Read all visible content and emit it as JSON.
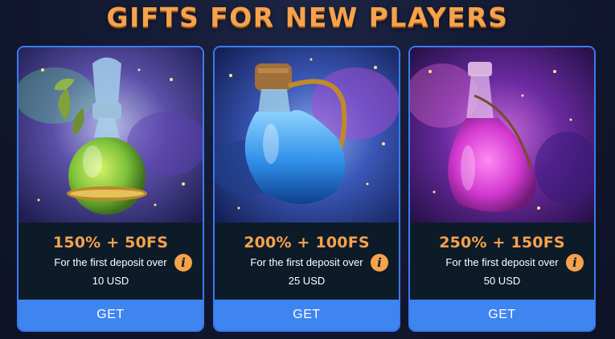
{
  "header": {
    "title": "GIFTS FOR NEW PLAYERS"
  },
  "colors": {
    "accent": "#f6a24c",
    "button": "#3f85f0",
    "border": "#3b7bf0",
    "panel": "#0d1b29"
  },
  "offers": [
    {
      "bonus": "150% + 50FS",
      "desc_line1": "For the first deposit over",
      "desc_line2": "10 USD",
      "button_label": "GET",
      "potion_color": "#7dc23a",
      "icon": "info-icon"
    },
    {
      "bonus": "200% + 100FS",
      "desc_line1": "For the first deposit over",
      "desc_line2": "25 USD",
      "button_label": "GET",
      "potion_color": "#3aa3f0",
      "icon": "info-icon"
    },
    {
      "bonus": "250% + 150FS",
      "desc_line1": "For the first deposit over",
      "desc_line2": "50 USD",
      "button_label": "GET",
      "potion_color": "#d43ad1",
      "icon": "info-icon"
    }
  ]
}
